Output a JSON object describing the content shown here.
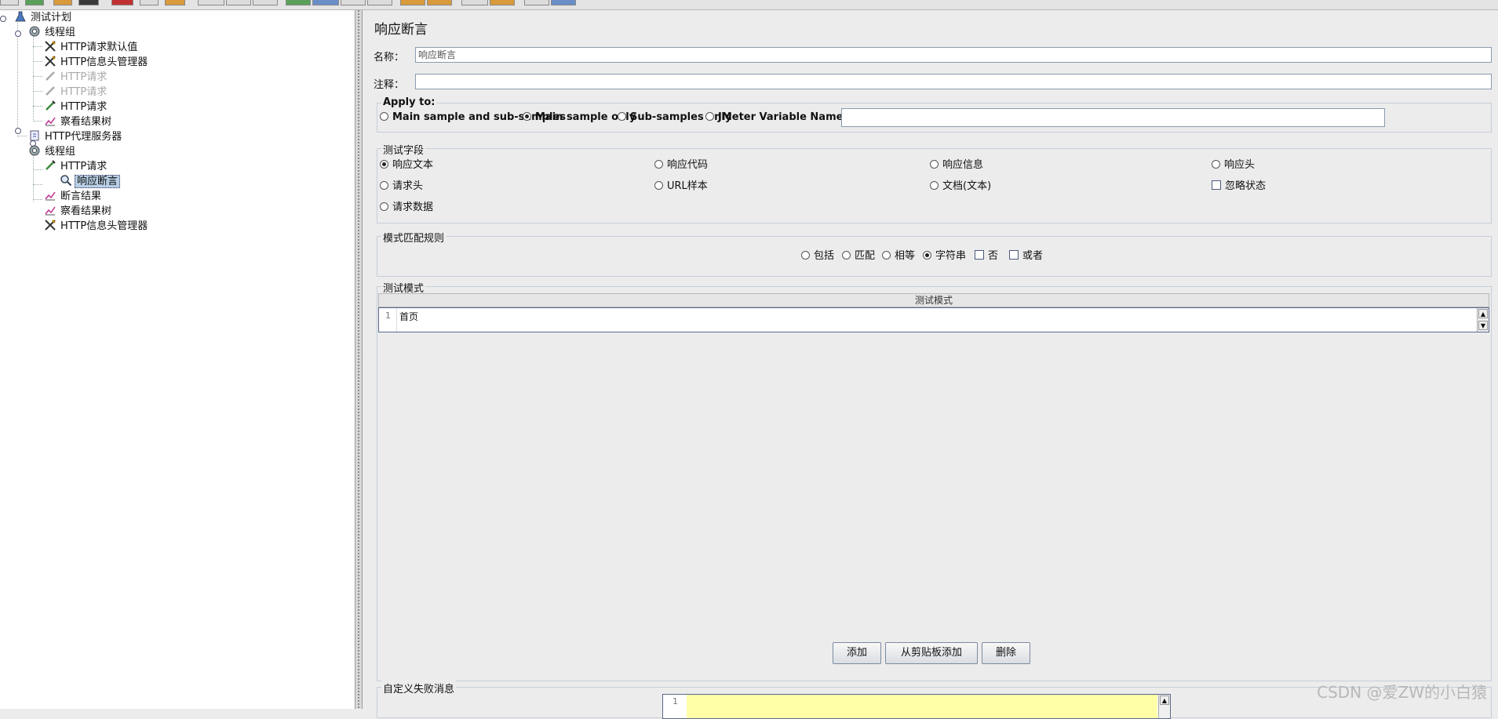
{
  "tree": {
    "items": [
      {
        "label": "测试计划"
      },
      {
        "label": "线程组"
      },
      {
        "label": "HTTP请求默认值"
      },
      {
        "label": "HTTP信息头管理器"
      },
      {
        "label": "HTTP请求"
      },
      {
        "label": "HTTP请求"
      },
      {
        "label": "HTTP请求"
      },
      {
        "label": "察看结果树"
      },
      {
        "label": "HTTP代理服务器"
      },
      {
        "label": "线程组"
      },
      {
        "label": "HTTP请求"
      },
      {
        "label": "响应断言"
      },
      {
        "label": "断言结果"
      },
      {
        "label": "察看结果树"
      },
      {
        "label": "HTTP信息头管理器"
      }
    ]
  },
  "panel": {
    "title": "响应断言",
    "name_label": "名称：",
    "name_value": "响应断言",
    "comment_label": "注释：",
    "comment_value": "",
    "apply_to": {
      "legend": "Apply to:",
      "options": [
        "Main sample and sub-samples",
        "Main sample only",
        "Sub-samples only",
        "JMeter Variable Name to use"
      ],
      "selected": "Main sample only",
      "variable_value": ""
    },
    "test_field": {
      "legend": "测试字段",
      "options": [
        "响应文本",
        "响应代码",
        "响应信息",
        "响应头",
        "请求头",
        "URL样本",
        "文档(文本)",
        "请求数据"
      ],
      "selected": "响应文本",
      "ignore_status": "忽略状态",
      "ignore_status_checked": false
    },
    "pattern_rules": {
      "legend": "模式匹配规则",
      "options": [
        "包括",
        "匹配",
        "相等",
        "字符串"
      ],
      "selected": "字符串",
      "not_label": "否",
      "or_label": "或者"
    },
    "test_patterns": {
      "legend": "测试模式",
      "column_header": "测试模式",
      "rows": [
        {
          "num": "1",
          "text": "首页"
        }
      ]
    },
    "buttons": {
      "add": "添加",
      "add_clipboard": "从剪贴板添加",
      "delete": "删除"
    },
    "custom_failure": {
      "legend": "自定义失败消息",
      "line_num": "1"
    }
  },
  "watermark": "CSDN @爱ZW的小白猿"
}
